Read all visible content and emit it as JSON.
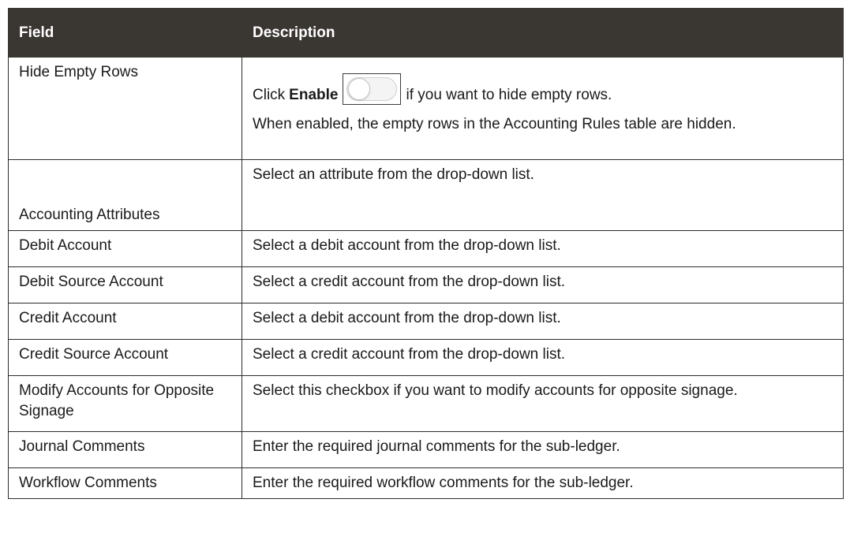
{
  "table": {
    "header": {
      "field": "Field",
      "description": "Description"
    },
    "hide_empty_rows": {
      "field": "Hide Empty Rows",
      "click_text": "Click",
      "enable_text": "Enable",
      "after_toggle_text": "if you want to hide empty rows.",
      "toggle_state": "off",
      "note": "When enabled, the empty rows in the Accounting Rules table are hidden."
    },
    "rows": [
      {
        "field": "Accounting Attributes",
        "description": "Select an attribute from the drop-down list."
      },
      {
        "field": "Debit Account",
        "description": "Select a debit account from the drop-down list."
      },
      {
        "field": "Debit Source Account",
        "description": "Select a credit account from the drop-down list."
      },
      {
        "field": "Credit Account",
        "description": "Select a debit account from the drop-down list."
      },
      {
        "field": "Credit Source Account",
        "description": "Select a credit account from the drop-down list."
      },
      {
        "field": "Modify Accounts for Opposite Signage",
        "description": "Select this checkbox if you want to modify accounts for opposite signage."
      },
      {
        "field": "Journal Comments",
        "description": "Enter the required journal comments for the sub-ledger."
      },
      {
        "field": "Workflow Comments",
        "description": "Enter the required workflow comments for the sub-ledger."
      }
    ]
  },
  "colors": {
    "header_bg": "#3a3632",
    "header_text": "#ffffff",
    "border": "#2b2b2b"
  }
}
